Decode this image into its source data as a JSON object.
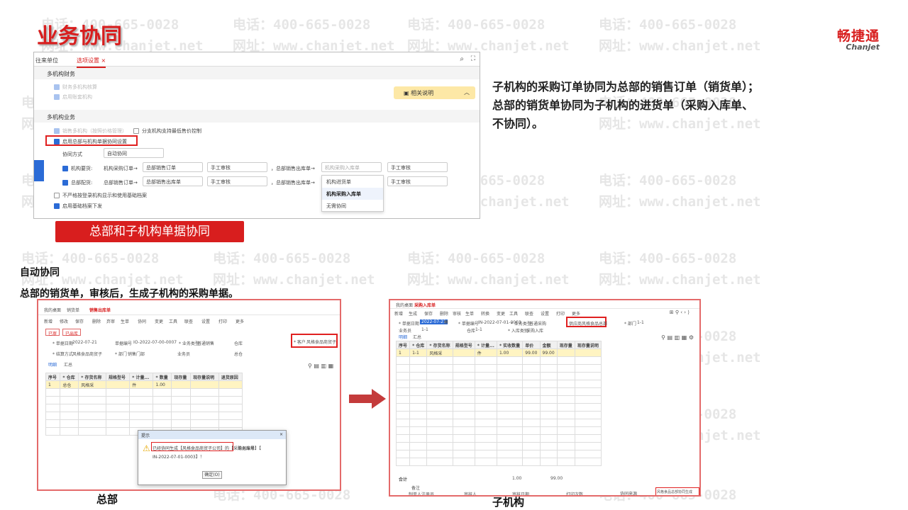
{
  "watermark": {
    "tel": "电话：400-665-0028",
    "web": "网址：www.chanjet.net"
  },
  "slide_title": "业务协同",
  "logo": {
    "cn": "畅捷通",
    "en": "Chanjet"
  },
  "settings_window": {
    "tabs": [
      "往来单位",
      "选项设置"
    ],
    "tab_close": "×",
    "section_finance": "多机构财务",
    "finance_options": [
      "财务多机构核算",
      "启用账套机构"
    ],
    "help_label": "相关说明",
    "section_business": "多机构业务",
    "business_option_faded": "销售多机构（按照价格管理）",
    "min_price_option": "分支机构支持最低售价控制",
    "enable_hq_sync": "启用总部与机构单据协同设置",
    "sync_mode_label": "协同方式",
    "sync_mode_value": "自动协同",
    "rows": [
      {
        "label": "机构要货:",
        "doc": "机构采购订单→",
        "target": "总部销售订单",
        "audit": "手工审核",
        "sep": "，总部销售出库单→",
        "target2": "机构采购入库单",
        "audit2": "手工审核"
      },
      {
        "label": "总部配货:",
        "doc": "总部销售订单→",
        "target": "总部销售出库单",
        "audit": "手工审核",
        "sep": "，总部销售出库单→",
        "target2": "",
        "audit2": "手工审核"
      }
    ],
    "dropdown_options": [
      "机构进货单",
      "机构采购入库单",
      "无需协同"
    ],
    "no_strict_option": "不严格按登录机构显示和使用基础档案",
    "base_archive_option": "启用基础档案下发"
  },
  "red_banner": "总部和子机构单据协同",
  "description": [
    "子机构的采购订单协同为总部的销售订单（销货单）；",
    "总部的销货单协同为子机构的进货单（采购入库单、",
    "不协同）。"
  ],
  "subtitle": "自动协同",
  "subtitle2": "总部的销货单，审核后，生成子机构的采购单据。",
  "hq_window": {
    "tabs": [
      "我的桌面",
      "销货单",
      "销售出库单"
    ],
    "toolbar": [
      "新增",
      "修改",
      "保存",
      "删除",
      "弃审",
      "生单",
      "协同",
      "变更",
      "工具",
      "联查",
      "设置",
      "打印",
      "更多"
    ],
    "stamps": [
      "已审",
      "已出库"
    ],
    "fields": {
      "date_label": "* 单据日期",
      "date": "2022-07-21",
      "no_label": "单据编号",
      "no": "IO-2022-07-00-0007",
      "biz_label": "* 业务类型",
      "biz": "普通销售",
      "dept_label": "* 部门",
      "dept": "销售门部",
      "staff_label": "业务员",
      "warehouse_label": "仓库",
      "warehouse": "总仓",
      "customer_label": "* 客户",
      "customer": "风格食品商贸子",
      "mode_label": "* 结算方式",
      "mode": "风格食品商贸子"
    },
    "subtabs": [
      "明细",
      "汇总"
    ],
    "columns": [
      "序号",
      "* 仓库",
      "* 存货名称",
      "规格型号",
      "* 计量...",
      "* 数量",
      "现存量",
      "现存量说明",
      "退货原因"
    ],
    "row": [
      "1",
      "总仓",
      "风格采",
      "",
      "件",
      "1.00",
      "",
      "",
      ""
    ],
    "dialog": {
      "title": "提示",
      "close": "×",
      "message": "已经协同生成【风格食品商贸子公司】的【采购入库单】",
      "ref_label": "单据编号：【",
      "ref_value": "IN-2022-07-01-0003】！",
      "ok": "确定(O)"
    }
  },
  "branch_window": {
    "tabs": [
      "我的桌面",
      "采购入库单"
    ],
    "toolbar": [
      "新增",
      "生成",
      "保存",
      "删除",
      "审核",
      "生单",
      "转换",
      "变更",
      "工具",
      "联查",
      "设置",
      "打印",
      "更多"
    ],
    "fields": {
      "date_label": "* 单据日期",
      "date": "2022-07-21",
      "no_label": "* 单据编号",
      "no": "IN-2022-07-01-0003",
      "biz_label": "* 业务类型",
      "biz": "普通采购",
      "supplier_label": "供应商",
      "supplier": "风格食品总部",
      "dept_label": "* 部门",
      "dept": "1-1",
      "wh_label": "仓库",
      "wh": "1-1",
      "srcdoc_label": "* 入库类别",
      "srcdoc": "采购入库",
      "staff_label": "业务员",
      "staff": "1-1"
    },
    "subtabs": [
      "明细",
      "汇总"
    ],
    "columns": [
      "序号",
      "* 仓库",
      "* 存货名称",
      "规格型号",
      "* 计量...",
      "* 实收数量",
      "单价",
      "金额",
      "现存量",
      "现存量说明"
    ],
    "row": [
      "1",
      "1-1",
      "风格采",
      "",
      "件",
      "1.00",
      "99.00",
      "99.00",
      "",
      ""
    ],
    "total": {
      "label": "合计",
      "qty": "1.00",
      "amount": "99.00"
    },
    "footer": {
      "note": "备注",
      "maker": "制单人",
      "maker_val": "注册员",
      "auditor": "审核人",
      "date": "审核日期",
      "print": "打印次数",
      "source": "协同来源",
      "source_val": "风格食品总部协同生成"
    }
  },
  "caption_hq": "总部",
  "caption_branch": "子机构"
}
